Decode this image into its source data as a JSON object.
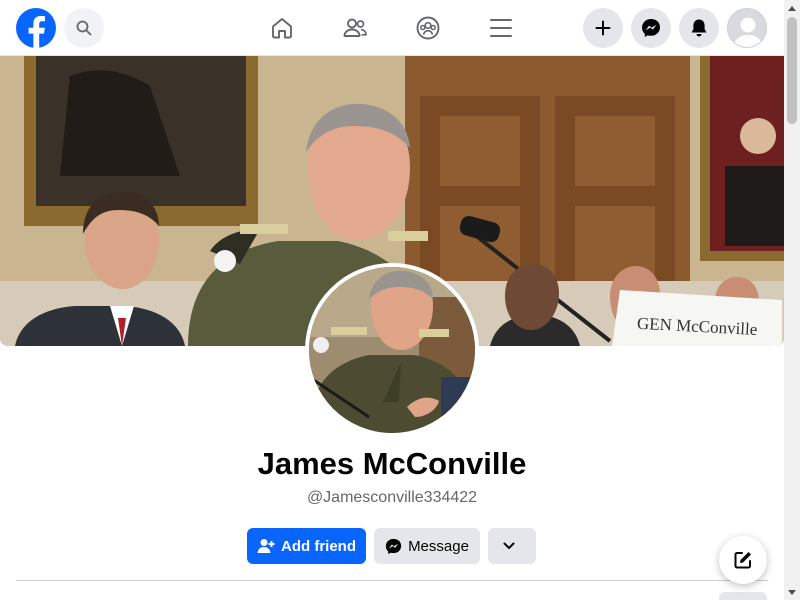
{
  "nav": {
    "logo": "facebook-logo",
    "search_icon": "search-icon",
    "tabs": [
      {
        "name": "home",
        "icon": "home-icon"
      },
      {
        "name": "friends",
        "icon": "friends-icon"
      },
      {
        "name": "groups",
        "icon": "groups-icon"
      },
      {
        "name": "menu",
        "icon": "menu-icon"
      }
    ],
    "actions": [
      "create-icon",
      "messenger-icon",
      "notifications-icon"
    ]
  },
  "profile": {
    "name": "James McConville",
    "handle": "@Jamesconville334422",
    "cover_sign": "GEN McConville"
  },
  "buttons": {
    "add_friend": "Add friend",
    "message": "Message"
  },
  "colors": {
    "brand": "#0866ff",
    "button_gray": "#e4e6eb",
    "text_primary": "#050505",
    "text_secondary": "#65676b"
  }
}
